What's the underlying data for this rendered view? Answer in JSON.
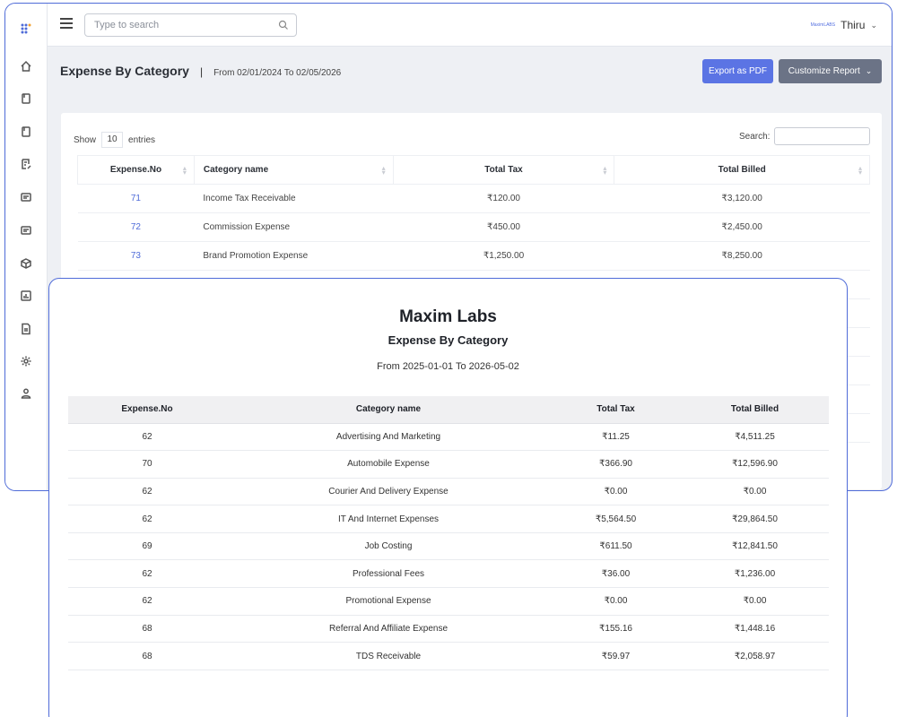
{
  "topbar": {
    "search_placeholder": "Type to search",
    "user_name": "Thiru",
    "user_brand": "MaximLABS"
  },
  "page": {
    "title": "Expense By Category",
    "separator": "|",
    "date_range": "From 02/01/2024 To 02/05/2026",
    "export_label": "Export as PDF",
    "customize_label": "Customize Report"
  },
  "table_controls": {
    "show_label": "Show",
    "entries_count": "10",
    "entries_label": "entries",
    "search_label": "Search:"
  },
  "main_table": {
    "headers": [
      "Expense.No",
      "Category name",
      "Total Tax",
      "Total Billed"
    ],
    "rows": [
      [
        "71",
        "Income Tax Receivable",
        "₹120.00",
        "₹3,120.00"
      ],
      [
        "72",
        "Commission Expense",
        "₹450.00",
        "₹2,450.00"
      ],
      [
        "73",
        "Brand Promotion Expense",
        "₹1,250.00",
        "₹8,250.00"
      ]
    ]
  },
  "report": {
    "company": "Maxim Labs",
    "title": "Expense By Category",
    "date_range": "From 2025-01-01 To 2026-05-02",
    "headers": [
      "Expense.No",
      "Category name",
      "Total Tax",
      "Total Billed"
    ],
    "rows": [
      [
        "62",
        "Advertising And Marketing",
        "₹11.25",
        "₹4,511.25"
      ],
      [
        "70",
        "Automobile Expense",
        "₹366.90",
        "₹12,596.90"
      ],
      [
        "62",
        "Courier And Delivery Expense",
        "₹0.00",
        "₹0.00"
      ],
      [
        "62",
        "IT And Internet Expenses",
        "₹5,564.50",
        "₹29,864.50"
      ],
      [
        "69",
        "Job Costing",
        "₹611.50",
        "₹12,841.50"
      ],
      [
        "62",
        "Professional Fees",
        "₹36.00",
        "₹1,236.00"
      ],
      [
        "62",
        "Promotional Expense",
        "₹0.00",
        "₹0.00"
      ],
      [
        "68",
        "Referral And Affiliate Expense",
        "₹155.16",
        "₹1,448.16"
      ],
      [
        "68",
        "TDS Receivable",
        "₹59.97",
        "₹2,058.97"
      ]
    ]
  },
  "colors": {
    "accent": "#5b74e4",
    "frame_border": "#4f6bd8",
    "customize_button": "#6b7386",
    "page_background": "#eef0f4"
  },
  "sidebar_icons": [
    "apps-grid-icon",
    "home-icon",
    "book-icon",
    "bookmark-icon",
    "edit-document-icon",
    "list-card-icon",
    "list-card-icon",
    "box-icon",
    "bar-chart-icon",
    "report-icon",
    "gear-icon",
    "user-icon"
  ]
}
